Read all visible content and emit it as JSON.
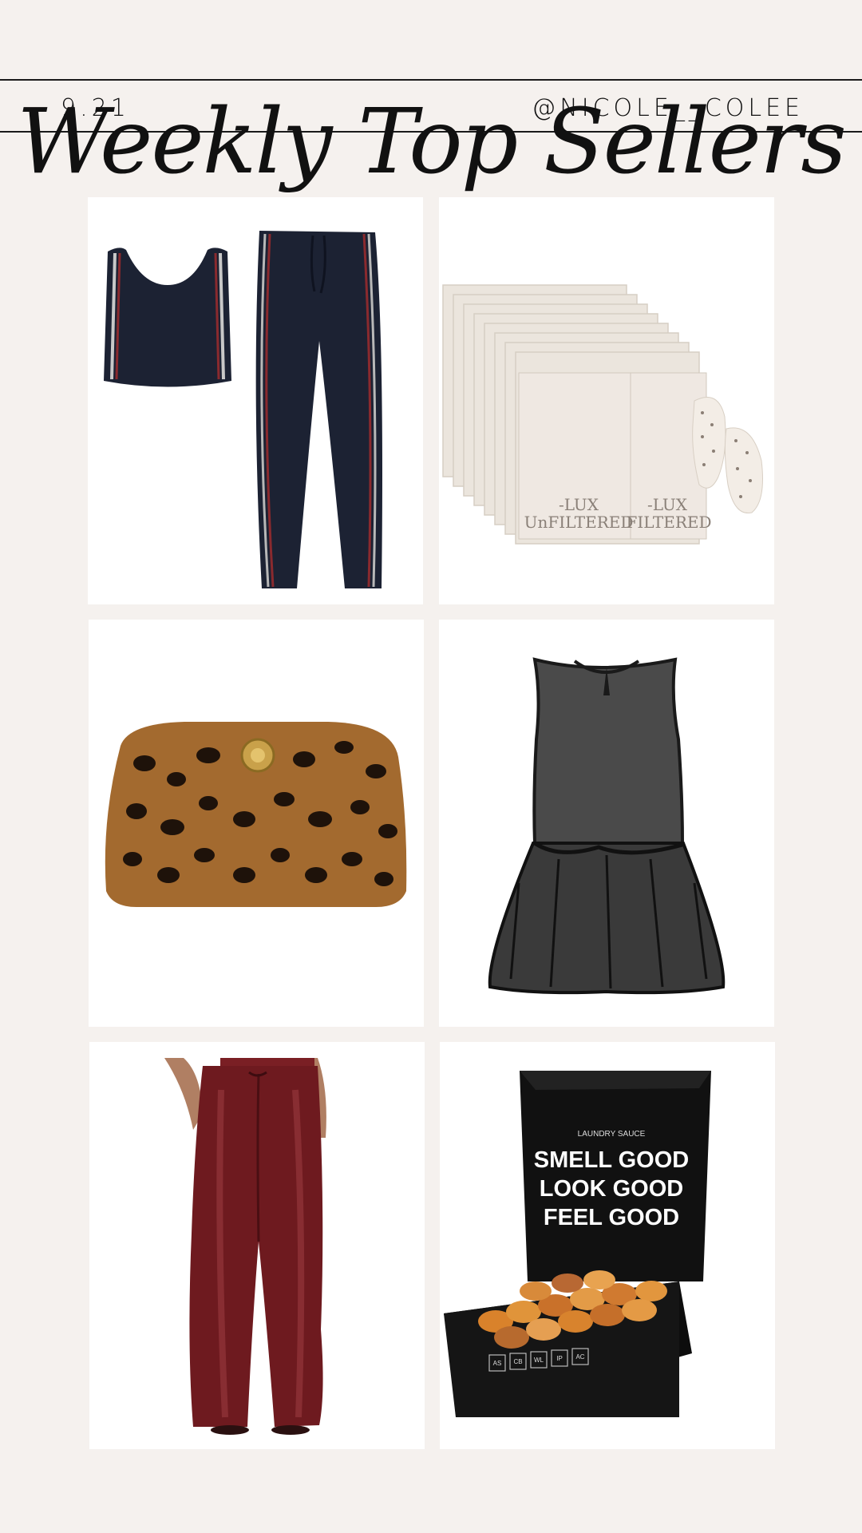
{
  "header": {
    "date": "9.21",
    "handle": "@NICOLE__COLEE",
    "title": "Weekly Top Sellers"
  },
  "products": [
    {
      "id": "athletic-set",
      "icon": "sports-bra-and-leggings"
    },
    {
      "id": "eye-patches",
      "icon": "under-eye-patches",
      "brand_text": "-LUX",
      "brand_text2": "UnFILTERED",
      "brand_text3": "FILTERED"
    },
    {
      "id": "leopard-pouch",
      "icon": "leopard-print-cosmetic-pouch"
    },
    {
      "id": "sheer-top",
      "icon": "sheer-peplum-top"
    },
    {
      "id": "satin-pants",
      "icon": "burgundy-satin-pants"
    },
    {
      "id": "laundry-box",
      "icon": "laundry-detergent-box",
      "brand_text": "LAUNDRY SAUCE",
      "lines": [
        "SMELL GOOD",
        "LOOK GOOD",
        "FEEL GOOD"
      ],
      "badges": [
        "AS",
        "CB",
        "WL",
        "IP",
        "AC"
      ]
    }
  ],
  "colors": {
    "background": "#f5f1ee",
    "card": "#ffffff",
    "navy": "#1c2233",
    "leopard": "#a36a2f",
    "burgundy": "#6e1a1f"
  }
}
